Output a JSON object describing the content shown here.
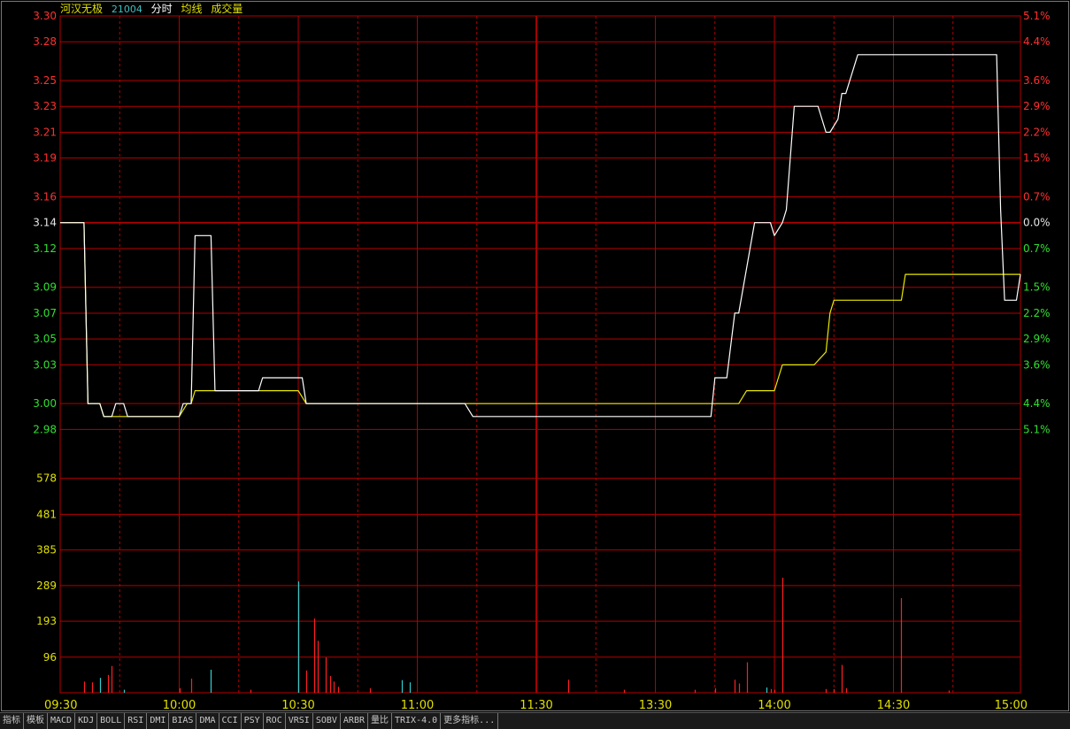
{
  "header": {
    "name": "河汉无极",
    "code": "21004",
    "labels": [
      "分时",
      "均线",
      "成交量"
    ]
  },
  "colors": {
    "grid": "#b40000",
    "price_up": "#ff3030",
    "price_down": "#30e030",
    "price_base": "#e6e6e6",
    "volume_axis": "#e0e000",
    "price_line": "#ffffff",
    "avg_line": "#e8e800",
    "vol_up": "#ff2020",
    "vol_down": "#30d0d0",
    "time_axis": "#e0e000"
  },
  "tabs": [
    "指标",
    "模板",
    "MACD",
    "KDJ",
    "BOLL",
    "RSI",
    "DMI",
    "BIAS",
    "DMA",
    "CCI",
    "PSY",
    "ROC",
    "VRSI",
    "SOBV",
    "ARBR",
    "量比",
    "TRIX-4.0",
    "更多指标..."
  ],
  "chart_data": {
    "type": "line",
    "price_axis": {
      "ylim": [
        2.97,
        3.3
      ],
      "base": 3.14,
      "ticks": [
        3.3,
        3.28,
        3.25,
        3.23,
        3.21,
        3.19,
        3.16,
        3.14,
        3.12,
        3.09,
        3.07,
        3.05,
        3.03,
        3.0,
        2.98
      ],
      "pct_ticks": [
        "5.1%",
        "4.4%",
        "3.6%",
        "2.9%",
        "2.2%",
        "1.5%",
        "0.7%",
        "0.0%",
        "0.7%",
        "1.5%",
        "2.2%",
        "2.9%",
        "3.6%",
        "4.4%",
        "5.1%"
      ]
    },
    "volume_axis": {
      "ylim": [
        0,
        675
      ],
      "ticks": [
        578,
        481,
        385,
        289,
        193,
        96
      ]
    },
    "time_ticks": [
      "09:30",
      "10:00",
      "10:30",
      "11:00",
      "11:30",
      "13:30",
      "14:00",
      "14:30",
      "15:00"
    ],
    "series": [
      {
        "key": "price",
        "points": [
          [
            0,
            3.14
          ],
          [
            6,
            3.14
          ],
          [
            7,
            3.0
          ],
          [
            10,
            3.0
          ],
          [
            11,
            2.99
          ],
          [
            12,
            2.99
          ],
          [
            13,
            2.99
          ],
          [
            14,
            3.0
          ],
          [
            16,
            3.0
          ],
          [
            17,
            2.99
          ],
          [
            30,
            2.99
          ],
          [
            31,
            3.0
          ],
          [
            33,
            3.0
          ],
          [
            34,
            3.13
          ],
          [
            38,
            3.13
          ],
          [
            39,
            3.01
          ],
          [
            50,
            3.01
          ],
          [
            51,
            3.02
          ],
          [
            61,
            3.02
          ],
          [
            62,
            3.0
          ],
          [
            92,
            3.0
          ],
          [
            93,
            3.0
          ],
          [
            102,
            3.0
          ],
          [
            104,
            2.99
          ],
          [
            164,
            2.99
          ],
          [
            165,
            3.02
          ],
          [
            168,
            3.02
          ],
          [
            170,
            3.07
          ],
          [
            171,
            3.07
          ],
          [
            175,
            3.14
          ],
          [
            179,
            3.14
          ],
          [
            180,
            3.13
          ],
          [
            182,
            3.14
          ],
          [
            183,
            3.15
          ],
          [
            185,
            3.23
          ],
          [
            191,
            3.23
          ],
          [
            193,
            3.21
          ],
          [
            194,
            3.21
          ],
          [
            196,
            3.22
          ],
          [
            197,
            3.24
          ],
          [
            198,
            3.24
          ],
          [
            200,
            3.26
          ],
          [
            201,
            3.27
          ],
          [
            236,
            3.27
          ],
          [
            237,
            3.15
          ],
          [
            238,
            3.08
          ],
          [
            241,
            3.08
          ],
          [
            242,
            3.1
          ]
        ]
      },
      {
        "key": "avg",
        "points": [
          [
            0,
            3.14
          ],
          [
            6,
            3.14
          ],
          [
            7,
            3.0
          ],
          [
            10,
            3.0
          ],
          [
            11,
            2.99
          ],
          [
            30,
            2.99
          ],
          [
            32,
            3.0
          ],
          [
            33,
            3.0
          ],
          [
            34,
            3.01
          ],
          [
            50,
            3.01
          ],
          [
            51,
            3.01
          ],
          [
            60,
            3.01
          ],
          [
            62,
            3.0
          ],
          [
            66,
            3.0
          ],
          [
            70,
            3.0
          ],
          [
            100,
            3.0
          ],
          [
            140,
            3.0
          ],
          [
            160,
            3.0
          ],
          [
            164,
            3.0
          ],
          [
            165,
            3.0
          ],
          [
            169,
            3.0
          ],
          [
            171,
            3.0
          ],
          [
            173,
            3.01
          ],
          [
            178,
            3.01
          ],
          [
            180,
            3.01
          ],
          [
            181,
            3.02
          ],
          [
            182,
            3.03
          ],
          [
            189,
            3.03
          ],
          [
            190,
            3.03
          ],
          [
            193,
            3.04
          ],
          [
            194,
            3.07
          ],
          [
            195,
            3.08
          ],
          [
            212,
            3.08
          ],
          [
            213,
            3.1
          ],
          [
            236,
            3.1
          ],
          [
            242,
            3.1
          ]
        ]
      }
    ],
    "volumes": [
      [
        6,
        30,
        "u"
      ],
      [
        8,
        28,
        "u"
      ],
      [
        10,
        40,
        "d"
      ],
      [
        12,
        48,
        "u"
      ],
      [
        13,
        72,
        "u"
      ],
      [
        16,
        8,
        "d"
      ],
      [
        30,
        12,
        "u"
      ],
      [
        33,
        38,
        "u"
      ],
      [
        38,
        62,
        "d"
      ],
      [
        48,
        8,
        "u"
      ],
      [
        60,
        300,
        "d"
      ],
      [
        62,
        60,
        "u"
      ],
      [
        64,
        200,
        "u"
      ],
      [
        65,
        140,
        "u"
      ],
      [
        67,
        95,
        "u"
      ],
      [
        68,
        45,
        "u"
      ],
      [
        69,
        30,
        "u"
      ],
      [
        70,
        16,
        "u"
      ],
      [
        78,
        12,
        "u"
      ],
      [
        86,
        34,
        "d"
      ],
      [
        88,
        28,
        "d"
      ],
      [
        128,
        35,
        "u"
      ],
      [
        142,
        8,
        "u"
      ],
      [
        160,
        8,
        "u"
      ],
      [
        165,
        12,
        "u"
      ],
      [
        170,
        35,
        "u"
      ],
      [
        171,
        25,
        "u"
      ],
      [
        173,
        82,
        "u"
      ],
      [
        178,
        14,
        "d"
      ],
      [
        179,
        10,
        "u"
      ],
      [
        180,
        8,
        "u"
      ],
      [
        182,
        310,
        "u"
      ],
      [
        193,
        10,
        "u"
      ],
      [
        195,
        10,
        "u"
      ],
      [
        197,
        75,
        "u"
      ],
      [
        198,
        12,
        "u"
      ],
      [
        212,
        255,
        "u"
      ],
      [
        224,
        6,
        "u"
      ]
    ]
  }
}
